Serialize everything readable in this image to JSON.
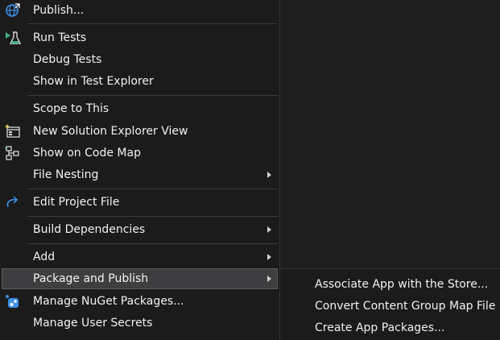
{
  "menu": {
    "items": [
      {
        "label": "Publish...",
        "icon": "globe-publish-icon"
      },
      {
        "label": "Run Tests",
        "icon": "beaker-run-icon"
      },
      {
        "label": "Debug Tests"
      },
      {
        "label": "Show in Test Explorer"
      },
      {
        "label": "Scope to This"
      },
      {
        "label": "New Solution Explorer View",
        "icon": "new-window-icon"
      },
      {
        "label": "Show on Code Map",
        "icon": "code-map-icon"
      },
      {
        "label": "File Nesting",
        "has_submenu": true
      },
      {
        "label": "Edit Project File",
        "icon": "edit-redo-icon"
      },
      {
        "label": "Build Dependencies",
        "has_submenu": true
      },
      {
        "label": "Add",
        "has_submenu": true
      },
      {
        "label": "Package and Publish",
        "has_submenu": true,
        "selected": true
      },
      {
        "label": "Manage NuGet Packages...",
        "icon": "nuget-icon"
      },
      {
        "label": "Manage User Secrets"
      }
    ]
  },
  "submenu": {
    "items": [
      {
        "label": "Associate App with the Store..."
      },
      {
        "label": "Convert Content Group Map File"
      },
      {
        "label": "Create App Packages..."
      }
    ]
  },
  "colors": {
    "menu_background": "#1b1b1c",
    "text": "#f1f1f1",
    "selected_background": "#3e3e40",
    "accent_blue": "#3c8ee8",
    "accent_green": "#3fb27f"
  }
}
